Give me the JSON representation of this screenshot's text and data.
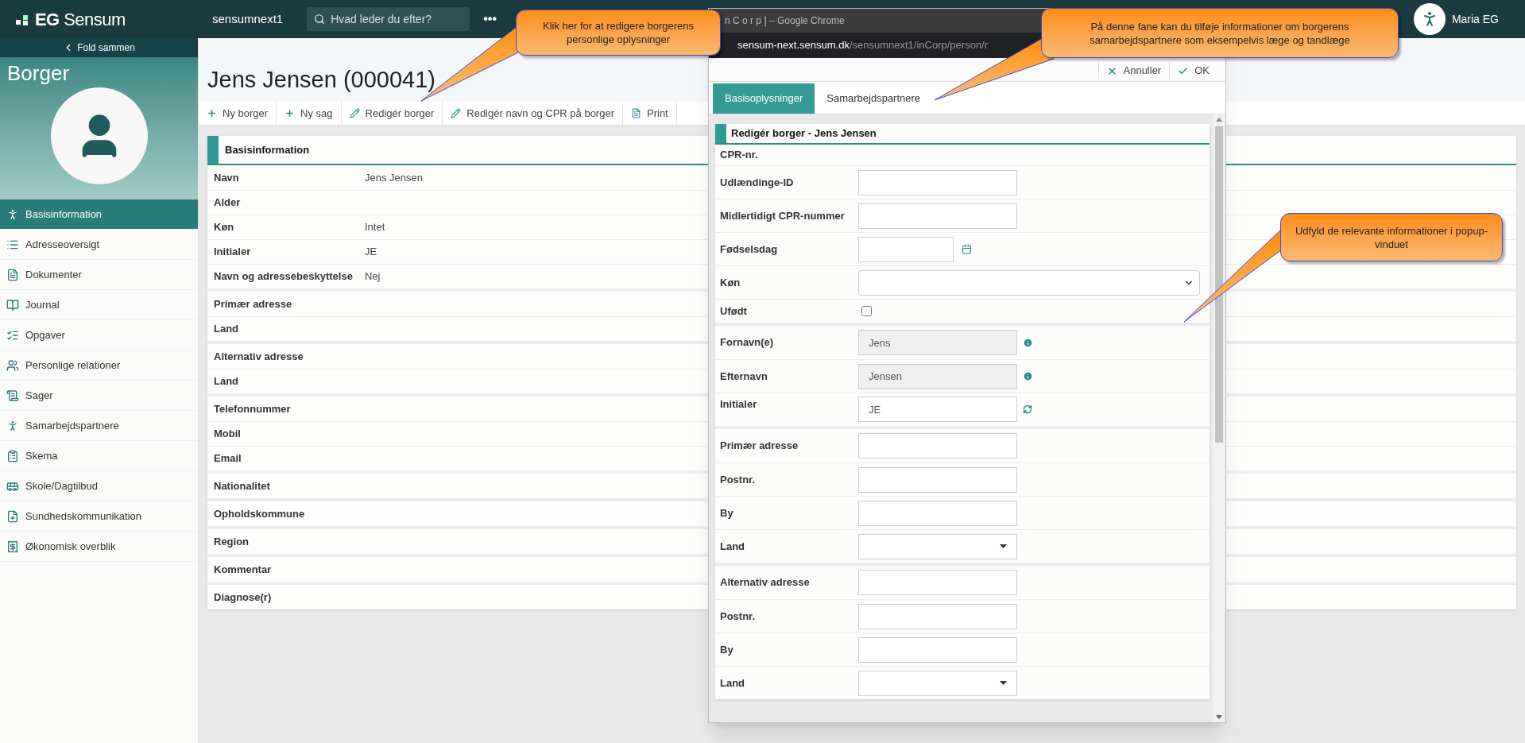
{
  "app_bar": {
    "logo": "**EG** Sensum",
    "workspace": "sensumnext1",
    "search": {
      "placeholder": "Hvad leder du efter?"
    },
    "more": "•••",
    "user": "Maria EG"
  },
  "sidebar": {
    "collapse": "Fold sammen",
    "heading": "Borger",
    "items": [
      {
        "label": "Basisinformation",
        "selected": true
      },
      {
        "label": "Adresseoversigt",
        "selected": false
      },
      {
        "label": "Dokumenter",
        "selected": false
      },
      {
        "label": "Journal",
        "selected": false
      },
      {
        "label": "Opgaver",
        "selected": false
      },
      {
        "label": "Personlige relationer",
        "selected": false
      },
      {
        "label": "Sager",
        "selected": false
      },
      {
        "label": "Samarbejdspartnere",
        "selected": false
      },
      {
        "label": "Skema",
        "selected": false
      },
      {
        "label": "Skole/Dagtilbud",
        "selected": false
      },
      {
        "label": "Sundhedskommunikation",
        "selected": false
      },
      {
        "label": "Økonomisk overblik",
        "selected": false
      }
    ]
  },
  "page": {
    "title": "Jens Jensen (000041)",
    "toolbar": [
      {
        "label": "Ny borger"
      },
      {
        "label": "Ny sag"
      },
      {
        "label": "Redigér borger"
      },
      {
        "label": "Redigér navn og CPR på borger"
      },
      {
        "label": "Print"
      }
    ],
    "card": {
      "title": "Basisinformation",
      "groups": [
        [
          {
            "label": "Navn",
            "value": "Jens Jensen"
          },
          {
            "label": "Alder"
          },
          {
            "label": "Køn",
            "value": "Intet"
          },
          {
            "label": "Initialer",
            "value": "JE"
          },
          {
            "label": "Navn og adressebeskyttelse",
            "value": "Nej"
          }
        ],
        [
          {
            "label": "Primær adresse"
          },
          {
            "label": "Land"
          }
        ],
        [
          {
            "label": "Alternativ adresse"
          },
          {
            "label": "Land"
          }
        ],
        [
          {
            "label": "Telefonnummer"
          },
          {
            "label": "Mobil"
          },
          {
            "label": "Email"
          }
        ],
        [
          {
            "label": "Nationalitet"
          }
        ],
        [
          {
            "label": "Opholdskommune"
          }
        ],
        [
          {
            "label": "Region"
          }
        ],
        [
          {
            "label": "Kommentar"
          }
        ],
        [
          {
            "label": "Diagnose(r)"
          }
        ]
      ]
    }
  },
  "popup": {
    "window_title": "n C o r p ] – Google Chrome",
    "url_host": "sensum-next.sensum.dk",
    "url_path": "/sensumnext1/inCorp/person/r",
    "actions": [
      {
        "label": "Annuller"
      },
      {
        "label": "OK"
      }
    ],
    "tabs": [
      {
        "label": "Basisoplysninger",
        "selected": true
      },
      {
        "label": "Samarbejdspartnere",
        "selected": false
      }
    ],
    "form": {
      "title": "Redigér borger - Jens Jensen",
      "groups": [
        [
          {
            "label": "CPR-nr.",
            "kind": "static"
          },
          {
            "label": "Udlændinge-ID",
            "kind": "text"
          },
          {
            "label": "Midlertidigt CPR-nummer",
            "kind": "text"
          },
          {
            "label": "Fødselsdag",
            "kind": "date"
          },
          {
            "label": "Køn",
            "kind": "select"
          },
          {
            "label": "Ufødt",
            "kind": "checkbox",
            "checked": false
          }
        ],
        [
          {
            "label": "Fornavn(e)",
            "kind": "locked",
            "value": "Jens"
          },
          {
            "label": "Efternavn",
            "kind": "locked",
            "value": "Jensen"
          },
          {
            "label": "Initialer",
            "kind": "initials",
            "value": "JE"
          }
        ],
        [
          {
            "label": "Primær adresse",
            "kind": "text"
          },
          {
            "label": "Postnr.",
            "kind": "text"
          },
          {
            "label": "By",
            "kind": "text"
          },
          {
            "label": "Land",
            "kind": "dropdown"
          }
        ],
        [
          {
            "label": "Alternativ adresse",
            "kind": "text"
          },
          {
            "label": "Postnr.",
            "kind": "text"
          },
          {
            "label": "By",
            "kind": "text"
          },
          {
            "label": "Land",
            "kind": "dropdown"
          }
        ]
      ]
    }
  },
  "callouts": [
    {
      "text": "Klik her for at redigere borgerens personlige oplysninger"
    },
    {
      "text": "På denne fane kan du tilføje informationer om borgerens samarbejdspartnere som eksempelvis læge og tandlæge"
    },
    {
      "text": "Udfyld de relevante informationer i popup-vinduet"
    }
  ]
}
